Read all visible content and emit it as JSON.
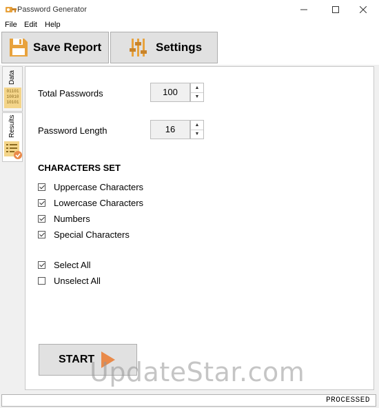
{
  "window": {
    "title": "Password Generator"
  },
  "menu": {
    "items": [
      "File",
      "Edit",
      "Help"
    ]
  },
  "toolbar": {
    "save_label": "Save Report",
    "settings_label": "Settings"
  },
  "tabs": {
    "data_label": "Data",
    "results_label": "Results",
    "data_icon_text": [
      "01101",
      "10010",
      "10101"
    ]
  },
  "fields": {
    "total_passwords": {
      "label": "Total Passwords",
      "value": "100"
    },
    "password_length": {
      "label": "Password Length",
      "value": "16"
    }
  },
  "characters": {
    "heading": "CHARACTERS SET",
    "options": [
      {
        "label": "Uppercase Characters",
        "checked": true
      },
      {
        "label": "Lowercase Characters",
        "checked": true
      },
      {
        "label": "Numbers",
        "checked": true
      },
      {
        "label": "Special Characters",
        "checked": true
      }
    ]
  },
  "selection": {
    "select_all": {
      "label": "Select All",
      "checked": true
    },
    "unselect_all": {
      "label": "Unselect All",
      "checked": false
    }
  },
  "start": {
    "label": "START"
  },
  "status": {
    "text": "PROCESSED"
  },
  "watermark": {
    "text": "UpdateStar.com"
  },
  "colors": {
    "accent_orange": "#e8a23c",
    "play_orange": "#e98a4a"
  }
}
